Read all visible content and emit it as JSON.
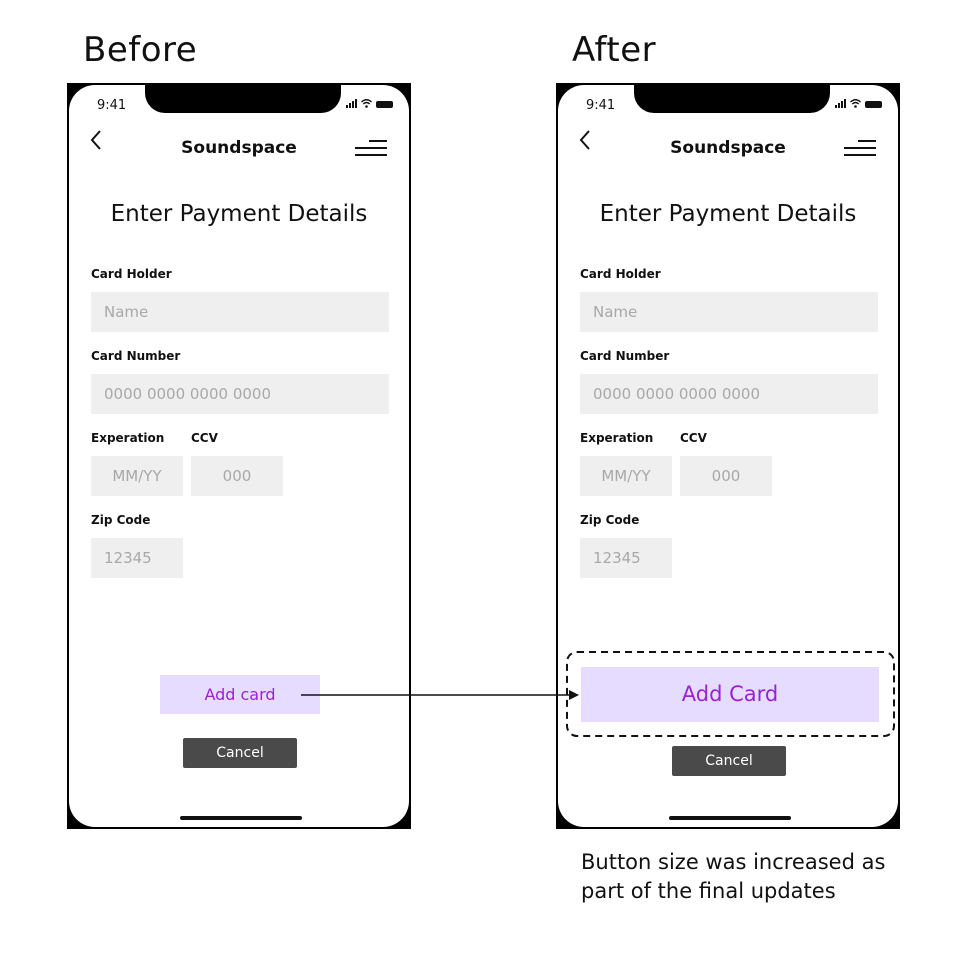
{
  "headings": {
    "before": "Before",
    "after": "After"
  },
  "phone": {
    "time": "9:41",
    "app_title": "Soundspace",
    "page_title": "Enter Payment Details",
    "card_holder_label": "Card Holder",
    "name_placeholder": "Name",
    "card_number_label": "Card Number",
    "card_number_placeholder": "0000 0000 0000 0000",
    "expiration_label": "Experation",
    "ccv_label": "CCV",
    "expiration_placeholder": "MM/YY",
    "ccv_placeholder": "000",
    "zip_label": "Zip Code",
    "zip_placeholder": "12345",
    "cancel_label": "Cancel"
  },
  "before": {
    "add_label": "Add card"
  },
  "after": {
    "add_label": "Add Card"
  },
  "note": "Button size was increased as part of the final updates",
  "colors": {
    "field_bg": "#efefef",
    "add_button_bg": "#e5dcff",
    "add_button_text": "#9b21d6",
    "cancel_button_bg": "#4a4a4a"
  },
  "icons": [
    "back-chevron-icon",
    "hamburger-menu-icon",
    "signal-icon",
    "wifi-icon",
    "battery-icon",
    "arrow-icon"
  ]
}
